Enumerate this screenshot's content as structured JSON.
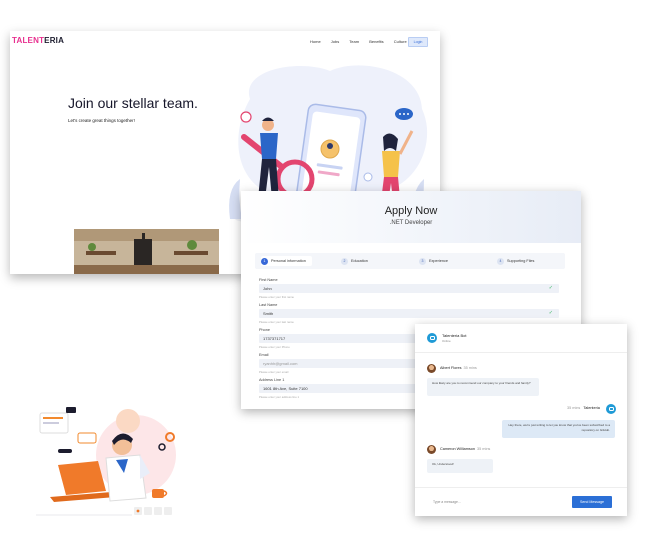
{
  "landing": {
    "logo_part1": "TALENT",
    "logo_part2": "ERIA",
    "nav": [
      "Home",
      "Jobs",
      "Team",
      "Benefits",
      "Culture"
    ],
    "login_label": "Login",
    "hero_title": "Join our stellar team.",
    "hero_subtitle": "Let's create great things together!"
  },
  "apply": {
    "title": "Apply Now",
    "subtitle": ".NET Developer",
    "steps": [
      {
        "num": "1",
        "label": "Personal information"
      },
      {
        "num": "2",
        "label": "Education"
      },
      {
        "num": "3",
        "label": "Experience"
      },
      {
        "num": "4",
        "label": "Supporting Files"
      }
    ],
    "fields": [
      {
        "label": "First Name",
        "value": "John",
        "help": "Please enter your first name",
        "valid": true
      },
      {
        "label": "Last Name",
        "value": "Smith",
        "help": "Please enter your last name",
        "valid": true
      },
      {
        "label": "Phone",
        "value": "1737371717",
        "help": "Please enter your Phone"
      },
      {
        "label": "Email",
        "value": "ryanhh@gmail.com",
        "help": "Please enter your email",
        "placeholder_style": true
      },
      {
        "label": "Address Line 1",
        "value": "1601 8th Ave, Suite 7100",
        "help": "Please enter your address line 1"
      }
    ]
  },
  "chat": {
    "bot_name": "Talenteria Bot",
    "bot_status": "Online",
    "messages": [
      {
        "author": "Albert Flores",
        "time": "35 mins",
        "text": "How likely are you to recommend our company to your friends and family?"
      },
      {
        "author": "Talenteria",
        "time": "35 mins",
        "text": "Hey there, we're just writing to let you know that you've been subscribed to a repository on GitHub.",
        "me": true
      },
      {
        "author": "Cameron Williamson",
        "time": "35 mins",
        "text": "Ok, Understood!"
      }
    ],
    "input_placeholder": "Type a message...",
    "send_label": "Send Message"
  }
}
